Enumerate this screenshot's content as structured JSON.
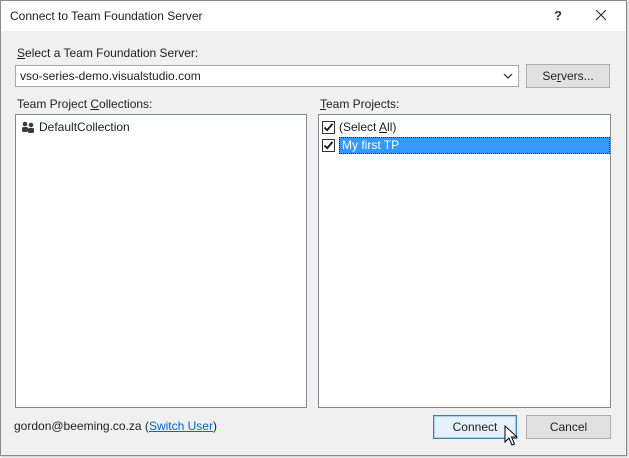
{
  "window": {
    "title": "Connect to Team Foundation Server",
    "help_label": "?",
    "close_label": "✕"
  },
  "server": {
    "label_prefix": "",
    "label_accel": "S",
    "label_rest": "elect a Team Foundation Server:",
    "selected": "vso-series-demo.visualstudio.com",
    "servers_button": {
      "pre": "Se",
      "accel": "r",
      "post": "vers..."
    }
  },
  "collections": {
    "label_pre": "Team Project ",
    "label_accel": "C",
    "label_post": "ollections:",
    "items": [
      "DefaultCollection"
    ]
  },
  "projects": {
    "label_pre": "",
    "label_accel": "T",
    "label_post": "eam Projects:",
    "select_all": {
      "pre": "(Select ",
      "accel": "A",
      "post": "ll)",
      "checked": true
    },
    "items": [
      {
        "label": "My first TP",
        "checked": true,
        "selected": true
      }
    ]
  },
  "footer": {
    "user": "gordon@beeming.co.za",
    "open_paren": " (",
    "switch_user": "Switch User",
    "close_paren": ")",
    "connect_label": "Connect",
    "cancel_label": "Cancel"
  },
  "colors": {
    "selection": "#3399ff",
    "link": "#0066cc",
    "default_button_border": "#3c7fb1"
  }
}
